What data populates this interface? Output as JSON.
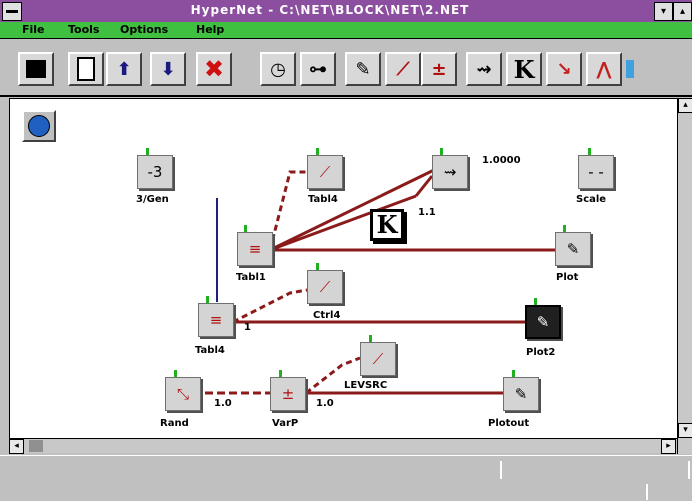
{
  "window": {
    "title": "HyperNet - C:\\NET\\BLOCK\\NET\\2.NET",
    "maximize_symbol": "▾",
    "restore_symbol": "▴"
  },
  "menu": [
    "File",
    "Tools",
    "Options",
    "Help"
  ],
  "toolbar": [
    "save-icon",
    "open-icon",
    "upload-icon",
    "download-icon",
    "delete-icon",
    "clock-icon",
    "plug-icon",
    "pipe-icon",
    "ramp-icon",
    "calc-icon",
    "arrow-icon",
    "K",
    "pulse-icon",
    "triangle-icon"
  ],
  "toolbar_k_label": "K",
  "nodes": {
    "n1": {
      "label": "3/Gen",
      "glyph": "-3"
    },
    "n2": {
      "label": "Tabl4",
      "glyph": "⟋"
    },
    "n3": {
      "glyph": "⇝",
      "value": "1.0000"
    },
    "n4": {
      "label": "Scale",
      "glyph": "- -"
    },
    "k": {
      "glyph": "K",
      "value": "1.1"
    },
    "n5": {
      "label": "Tabl1",
      "glyph": "≡"
    },
    "n6": {
      "label": "Plot",
      "glyph": "✎"
    },
    "n7": {
      "label": "Ctrl4",
      "glyph": "⟋"
    },
    "n8": {
      "label": "Tabl4",
      "glyph": "≡",
      "value": "1"
    },
    "n9": {
      "label": "Plot2",
      "glyph": "✎"
    },
    "n10": {
      "label": "LEVSRC",
      "glyph": "⟋"
    },
    "n11": {
      "label": "Rand",
      "glyph": "⤡",
      "value": "1.0"
    },
    "n12": {
      "label": "VarP",
      "glyph": "±",
      "value": "1.0"
    },
    "n13": {
      "label": "Plotout",
      "glyph": "✎"
    }
  },
  "colors": {
    "title": "#8c4fa0",
    "menu": "#40c040",
    "wire": "#8b1a1a",
    "wire_blue": "#202080"
  }
}
